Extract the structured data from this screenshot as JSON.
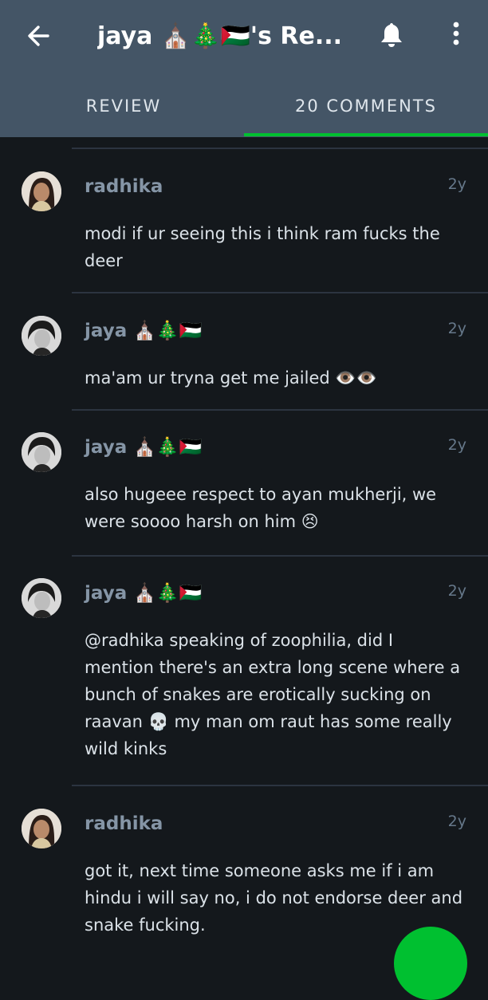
{
  "header": {
    "title": "jaya ⛪🎄🇵🇸's Re...",
    "back_icon": "arrow-left-icon",
    "bell_icon": "bell-icon",
    "more_icon": "more-vertical-icon"
  },
  "tabs": [
    {
      "label": "REVIEW",
      "active": false
    },
    {
      "label": "20 COMMENTS",
      "active": true
    }
  ],
  "colors": {
    "header_bg": "#445566",
    "page_bg": "#14181c",
    "accent": "#00c030",
    "username": "#8595a6",
    "comment_text": "#dbe2e8"
  },
  "comments": [
    {
      "username": "radhika",
      "time": "2y",
      "text_lines": [
        "modi if ur seeing this i think ram fucks the",
        "deer"
      ]
    },
    {
      "username": "jaya ⛪🎄🇵🇸",
      "time": "2y",
      "text_lines": [
        "ma'am ur tryna get me jailed 👁️👁️"
      ]
    },
    {
      "username": "jaya ⛪🎄🇵🇸",
      "time": "2y",
      "text_lines": [
        "also hugeee respect to ayan mukherji, we",
        "were soooo harsh on him 😣"
      ]
    },
    {
      "username": "jaya ⛪🎄🇵🇸",
      "time": "2y",
      "text_lines": [
        "@radhika speaking of zoophilia, did I",
        "mention there's an extra long scene where a",
        "bunch of snakes are erotically sucking on",
        "raavan 💀 my man om raut has some really",
        "wild kinks"
      ]
    },
    {
      "username": "radhika",
      "time": "2y",
      "text_lines": [
        "got it, next time someone asks me if i am",
        "hindu i will say no, i do not endorse deer and",
        "snake fucking."
      ]
    }
  ]
}
